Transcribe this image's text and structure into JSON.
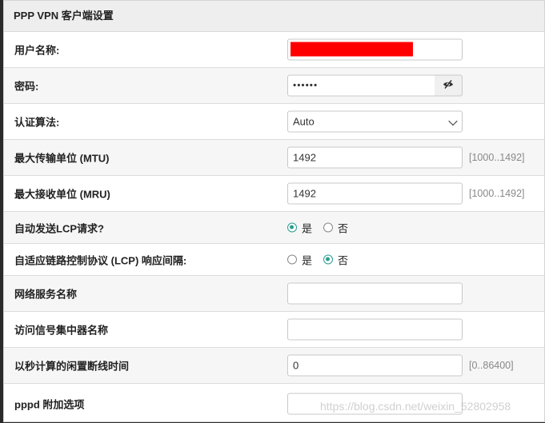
{
  "panel": {
    "title": "PPP VPN 客户端设置"
  },
  "rows": {
    "username": {
      "label": "用户名称:"
    },
    "password": {
      "label": "密码:",
      "value": "••••••"
    },
    "auth": {
      "label": "认证算法:",
      "value": "Auto"
    },
    "mtu": {
      "label": "最大传输单位 (MTU)",
      "value": "1492",
      "hint": "[1000..1492]"
    },
    "mru": {
      "label": "最大接收单位 (MRU)",
      "value": "1492",
      "hint": "[1000..1492]"
    },
    "lcp_request": {
      "label": "自动发送LCP请求?",
      "yes": "是",
      "no": "否",
      "selected": "yes"
    },
    "lcp_adaptive": {
      "label": "自适应链路控制协议 (LCP) 响应间隔:",
      "yes": "是",
      "no": "否",
      "selected": "no"
    },
    "service_name": {
      "label": "网络服务名称",
      "value": ""
    },
    "ac_name": {
      "label": "访问信号集中器名称",
      "value": ""
    },
    "idle_timeout": {
      "label": "以秒计算的闲置断线时间",
      "value": "0",
      "hint": "[0..86400]"
    },
    "pppd_options": {
      "label": "pppd 附加选项",
      "value": ""
    }
  },
  "icons": {
    "eye": "eye-slash-icon",
    "select_arrow": "chevron-down-icon"
  },
  "colors": {
    "radio_accent": "#2a9d8f",
    "redaction": "#ff0000"
  },
  "watermark": "https://blog.csdn.net/weixin_52802958"
}
